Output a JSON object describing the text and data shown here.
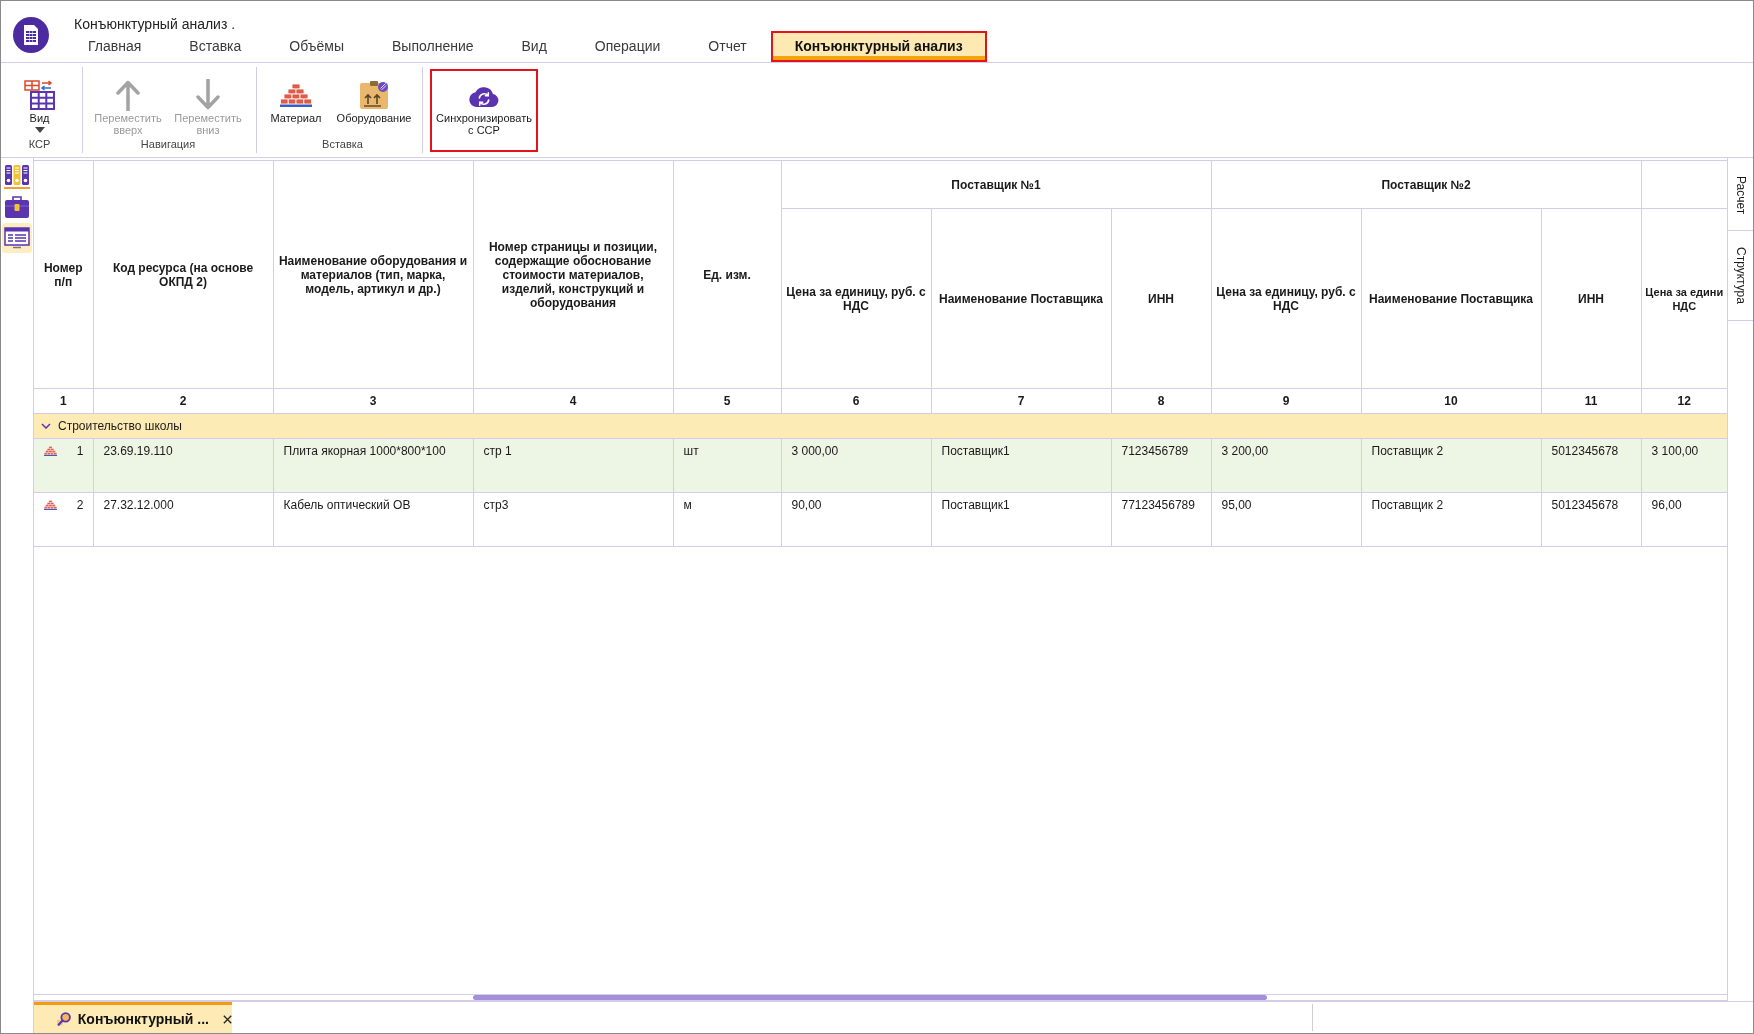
{
  "window": {
    "title": "Конъюнктурный анализ ."
  },
  "tabs": [
    {
      "label": "Главная",
      "selected": false,
      "highlighted": false
    },
    {
      "label": "Вставка",
      "selected": false,
      "highlighted": false
    },
    {
      "label": "Объёмы",
      "selected": false,
      "highlighted": false
    },
    {
      "label": "Выполнение",
      "selected": false,
      "highlighted": false
    },
    {
      "label": "Вид",
      "selected": false,
      "highlighted": false
    },
    {
      "label": "Операции",
      "selected": false,
      "highlighted": false
    },
    {
      "label": "Отчет",
      "selected": false,
      "highlighted": false
    },
    {
      "label": "Конъюнктурный анализ",
      "selected": true,
      "highlighted": true
    }
  ],
  "ribbon": {
    "groups": [
      {
        "label": "КСР",
        "buttons": [
          {
            "kind": "view",
            "label": "Вид",
            "dropdown": true,
            "disabled": false,
            "highlighted": false
          }
        ]
      },
      {
        "label": "Навигация",
        "buttons": [
          {
            "kind": "move_up",
            "label": "Переместить\nвверх",
            "dropdown": false,
            "disabled": true,
            "highlighted": false
          },
          {
            "kind": "move_down",
            "label": "Переместить\nвниз",
            "dropdown": false,
            "disabled": true,
            "highlighted": false
          }
        ]
      },
      {
        "label": "Вставка",
        "buttons": [
          {
            "kind": "material",
            "label": "Материал",
            "dropdown": false,
            "disabled": false,
            "highlighted": false
          },
          {
            "kind": "equipment",
            "label": "Оборудование",
            "dropdown": false,
            "disabled": false,
            "highlighted": false
          }
        ]
      },
      {
        "buttons": [
          {
            "kind": "sync",
            "label": "Синхронизировать\nс ССР",
            "dropdown": false,
            "disabled": false,
            "highlighted": true
          }
        ]
      }
    ]
  },
  "side_panel": {
    "items": [
      {
        "kind": "binders",
        "selected": false
      },
      {
        "kind": "toolbox",
        "selected": false
      },
      {
        "kind": "form",
        "selected": true
      }
    ]
  },
  "table": {
    "columns": [
      {
        "header": "Номер п/п",
        "number": "1"
      },
      {
        "header": "Код ресурса (на основе ОКПД 2)",
        "number": "2"
      },
      {
        "header": "Наименование оборудования и материалов (тип, марка, модель, артикул и др.)",
        "number": "3"
      },
      {
        "header": "Номер страницы и позиции, содержащие обоснование стоимости материалов, изделий, конструкций и оборудования",
        "number": "4"
      },
      {
        "header": "Ед. изм.",
        "number": "5"
      }
    ],
    "column_groups": [
      {
        "title": "Поставщик №1",
        "columns": [
          {
            "header": "Цена за единицу, руб. с НДС",
            "number": "6"
          },
          {
            "header": "Наименование Поставщика",
            "number": "7"
          },
          {
            "header": "ИНН",
            "number": "8"
          }
        ]
      },
      {
        "title": "Поставщик №2",
        "columns": [
          {
            "header": "Цена за единицу, руб. с НДС",
            "number": "9"
          },
          {
            "header": "Наименование Поставщика",
            "number": "10"
          },
          {
            "header": "ИНН",
            "number": "11"
          }
        ]
      },
      {
        "columns": [
          {
            "header": "Цена за едини\nНДС",
            "number": "12"
          }
        ]
      }
    ],
    "sections": [
      {
        "title": "Строительство школы",
        "expanded": true,
        "rows": [
          {
            "kind": "material",
            "selected": true,
            "cells": [
              "1",
              "23.69.19.110",
              "Плита якорная 1000*800*100",
              "стр 1",
              "шт",
              "3 000,00",
              "Поставщик1",
              "7123456789",
              "3 200,00",
              "Поставщик 2",
              "5012345678",
              "3 100,00"
            ]
          },
          {
            "kind": "material",
            "selected": false,
            "cells": [
              "2",
              "27.32.12.000",
              "Кабель оптический ОВ",
              "стр3",
              "м",
              "90,00",
              "Поставщик1",
              "77123456789",
              "95,00",
              "Поставщик 2",
              "5012345678",
              "96,00"
            ]
          }
        ]
      }
    ]
  },
  "right_panel": {
    "tabs": [
      {
        "label": "Расчет"
      },
      {
        "label": "Структура"
      }
    ]
  },
  "document_tabs": [
    {
      "label": "Конъюнктурный ...",
      "selected": true
    }
  ]
}
